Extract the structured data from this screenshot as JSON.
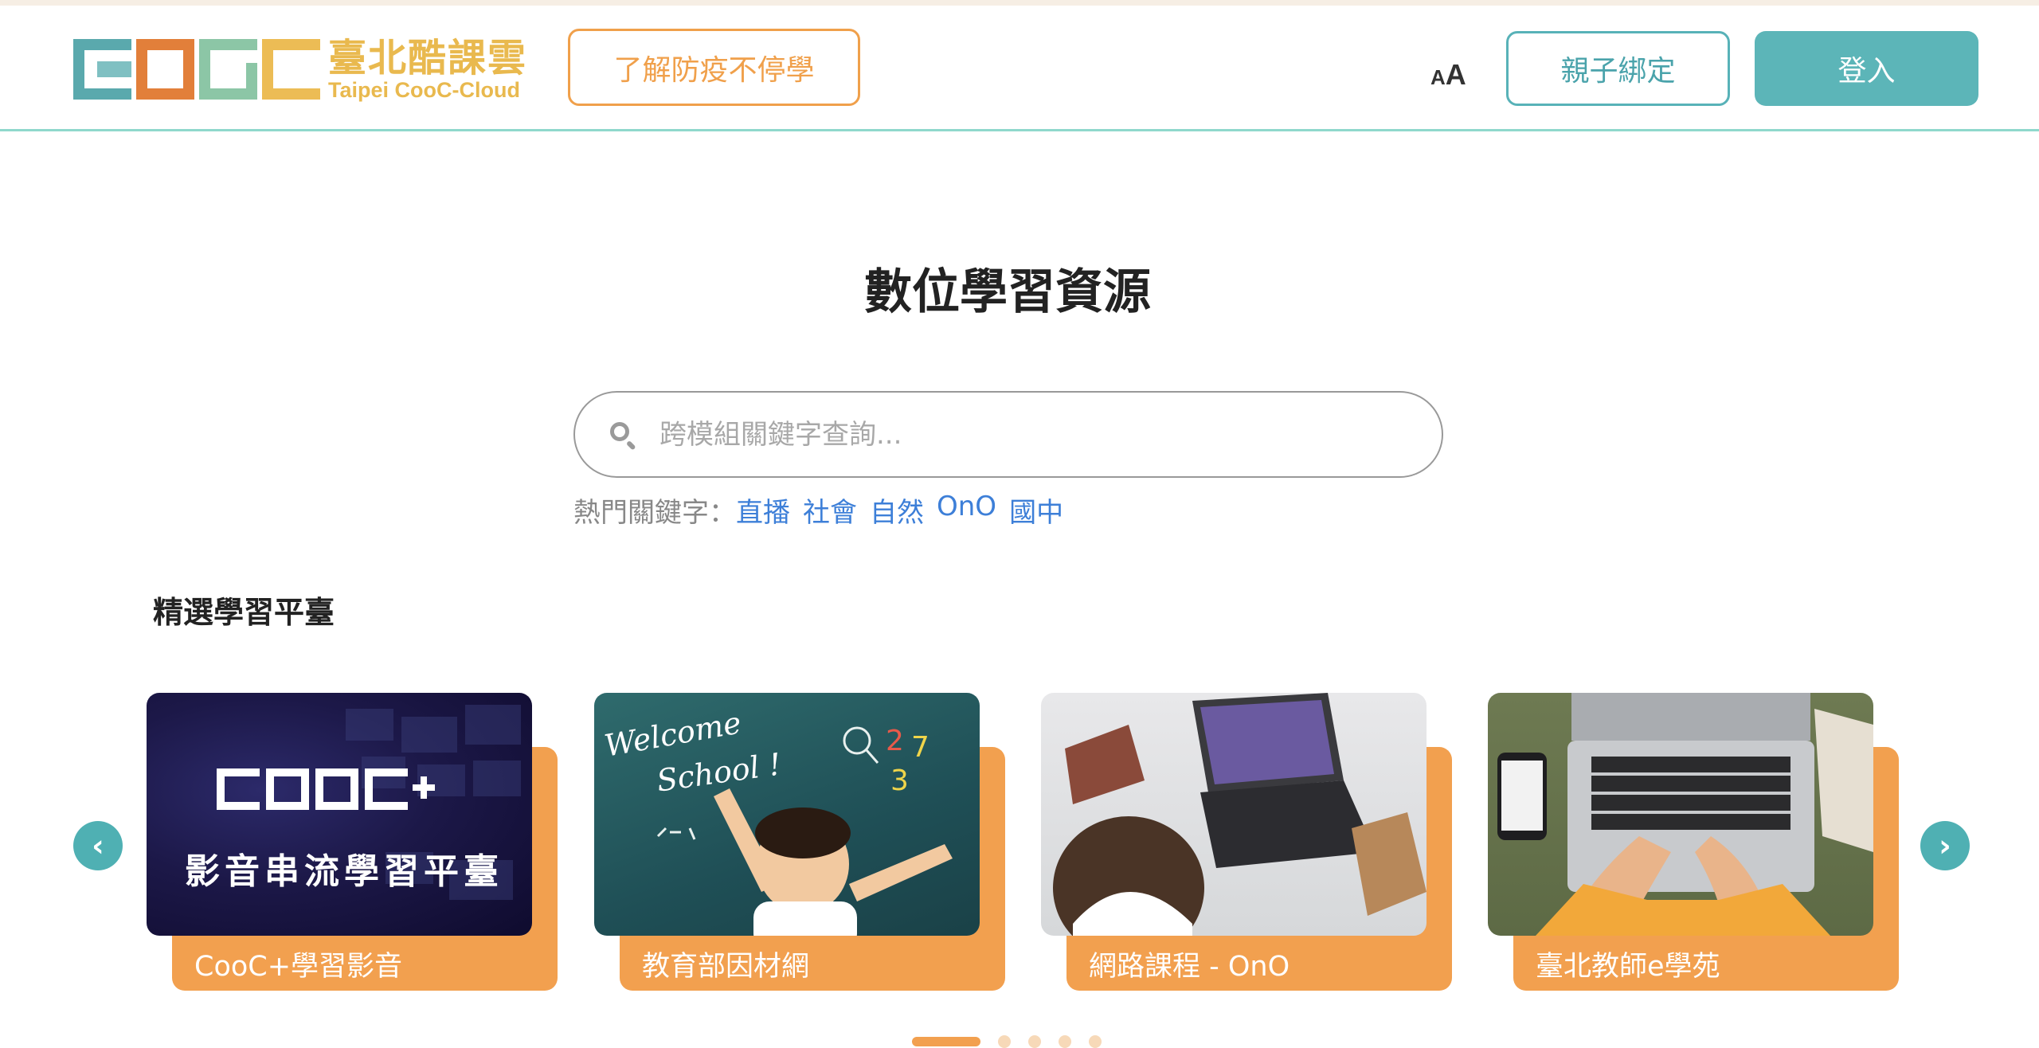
{
  "header": {
    "logo_cn": "臺北酷課雲",
    "logo_en": "Taipei CooC-Cloud",
    "learn_button": "了解防疫不停學",
    "font_size_small": "A",
    "font_size_large": "A",
    "bind_button": "親子綁定",
    "login_button": "登入"
  },
  "main": {
    "title": "數位學習資源",
    "search_placeholder": "跨模組關鍵字查詢...",
    "hot_label": "熱門關鍵字：",
    "hot_keywords": [
      "直播",
      "社會",
      "自然",
      "OnO",
      "國中"
    ]
  },
  "featured": {
    "title": "精選學習平臺",
    "cards": [
      {
        "label": "CooC+學習影音",
        "image_text_1": "COOC+",
        "image_text_2": "影音串流學習平臺"
      },
      {
        "label": "教育部因材網",
        "image_text_1": "Welcome",
        "image_text_2": "School !"
      },
      {
        "label": "網路課程 - OnO"
      },
      {
        "label": "臺北教師e學苑"
      }
    ],
    "active_slide": 1,
    "slide_count": 5
  },
  "colors": {
    "teal": "#5cb5b8",
    "orange": "#f2a04f",
    "logo_gold": "#e9b94e",
    "link_blue": "#3d7fd8"
  }
}
